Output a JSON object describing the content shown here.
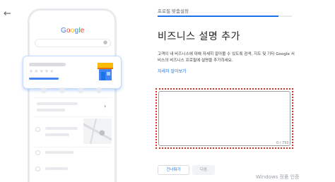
{
  "nav": {
    "back_icon": "arrow-left-icon"
  },
  "illustration": {
    "google_logo": [
      "G",
      "o",
      "o",
      "g",
      "l",
      "e"
    ],
    "stars": "★★★★★",
    "store_icon": "store-icon",
    "chevron": "›",
    "map_pin": "map-pin-icon"
  },
  "progress": {
    "step_label": "프로필 맞춤설정",
    "fraction": 0.9
  },
  "main": {
    "title": "비즈니스 설명 추가",
    "description": "고객이 내 비즈니스에 대해 자세히 알아볼 수 있도록 검색, 지도 및 기타 Google 서비스의 비즈니스 프로필에 설명을 추가하세요.",
    "learn_more": "자세히 알아보기",
    "textarea_value": "",
    "counter": "0 / 750"
  },
  "actions": {
    "skip_label": "건너뛰기",
    "next_label": "다음"
  },
  "watermark": "Windows 정품 인증",
  "colors": {
    "accent": "#1a73e8",
    "highlight_outline": "#d93025"
  }
}
